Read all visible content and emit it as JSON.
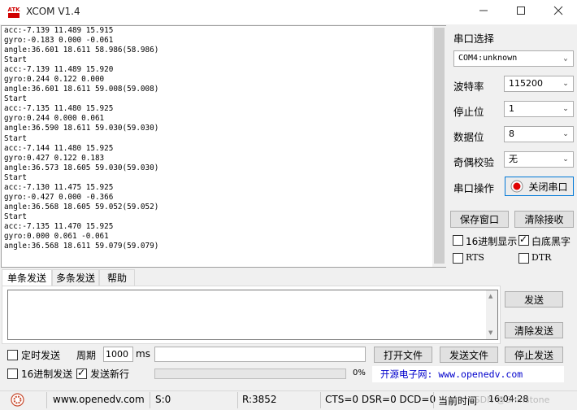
{
  "window": {
    "logo_text": "ATK",
    "title": "XCOM V1.4",
    "minimize_icon": "minimize-icon",
    "maximize_icon": "maximize-icon",
    "close_icon": "close-icon"
  },
  "receive": {
    "text": "acc:-7.139 11.489 15.915\ngyro:-0.183 0.000 -0.061\nangle:36.601 18.611 58.986(58.986)\nStart\nacc:-7.139 11.489 15.920\ngyro:0.244 0.122 0.000\nangle:36.601 18.611 59.008(59.008)\nStart\nacc:-7.135 11.480 15.925\ngyro:0.244 0.000 0.061\nangle:36.590 18.611 59.030(59.030)\nStart\nacc:-7.144 11.480 15.925\ngyro:0.427 0.122 0.183\nangle:36.573 18.605 59.030(59.030)\nStart\nacc:-7.130 11.475 15.925\ngyro:-0.427 0.000 -0.366\nangle:36.568 18.605 59.052(59.052)\nStart\nacc:-7.135 11.470 15.925\ngyro:0.000 0.061 -0.061\nangle:36.568 18.611 59.079(59.079)"
  },
  "settings": {
    "port_label": "串口选择",
    "port_value": "COM4:unknown",
    "baud_label": "波特率",
    "baud_value": "115200",
    "stopbits_label": "停止位",
    "stopbits_value": "1",
    "databits_label": "数据位",
    "databits_value": "8",
    "parity_label": "奇偶校验",
    "parity_value": "无",
    "op_label": "串口操作",
    "close_port_label": "关闭串口",
    "save_window_label": "保存窗口",
    "clear_recv_label": "清除接收",
    "hex_display_label": "16进制显示",
    "hex_display_checked": false,
    "white_black_label": "白底黑字",
    "white_black_checked": true,
    "rts_label": "RTS",
    "rts_checked": false,
    "dtr_label": "DTR",
    "dtr_checked": false
  },
  "tabs": [
    {
      "label": "单条发送",
      "active": true
    },
    {
      "label": "多条发送",
      "active": false
    },
    {
      "label": "帮助",
      "active": false
    }
  ],
  "send": {
    "text": "",
    "send_label": "发送",
    "clear_send_label": "清除发送",
    "timed_send_label": "定时发送",
    "timed_send_checked": false,
    "period_label": "周期",
    "period_value": "1000",
    "period_unit": "ms",
    "file_path": "",
    "open_file_label": "打开文件",
    "send_file_label": "发送文件",
    "stop_send_label": "停止发送",
    "hex_send_label": "16进制发送",
    "hex_send_checked": false,
    "newline_label": "发送新行",
    "newline_checked": true,
    "progress_text": "0%",
    "progress_value": 0,
    "promo": "开源电子网: www.openedv.com"
  },
  "status": {
    "gear_icon": "gear-icon",
    "url": "www.openedv.com",
    "sent": "S:0",
    "received": "R:3852",
    "lines": "CTS=0 DSR=0 DCD=0",
    "time_label": "当前时间",
    "time": "16:04:28",
    "watermark": "CSDN @Shinstone"
  },
  "colors": {
    "accent": "#0078d7",
    "promo_blue": "#0000cc",
    "close_port_red": "#e00000"
  }
}
